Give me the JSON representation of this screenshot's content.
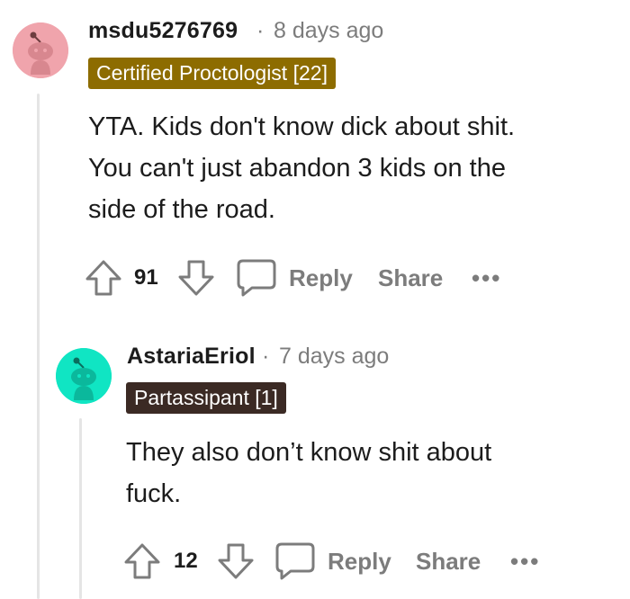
{
  "comments": [
    {
      "username": "msdu5276769",
      "separator": "·",
      "timestamp": "8 days ago",
      "flair": "Certified Proctologist [22]",
      "flair_color": "#8d6c00",
      "avatar_bg": "#f0a4ac",
      "body": "YTA. Kids don't know dick about shit.\nYou can't just abandon 3 kids on the\nside of the road.",
      "score": "91",
      "reply_label": "Reply",
      "share_label": "Share",
      "more_label": "•••",
      "icons": [
        "upvote-icon",
        "downvote-icon",
        "comment-bubble-icon",
        "more-icon"
      ]
    },
    {
      "username": "AstariaEriol",
      "separator": "·",
      "timestamp": "7 days ago",
      "flair": "Partassipant [1]",
      "flair_color": "#3b2a24",
      "avatar_bg": "#10e5c3",
      "body": "They also don’t know shit about\nfuck.",
      "score": "12",
      "reply_label": "Reply",
      "share_label": "Share",
      "more_label": "•••",
      "icons": [
        "upvote-icon",
        "downvote-icon",
        "comment-bubble-icon",
        "more-icon"
      ]
    }
  ],
  "colors": {
    "text": "#1c1c1c",
    "muted": "#7c7c7c",
    "thread_line": "#e5e5e5"
  }
}
